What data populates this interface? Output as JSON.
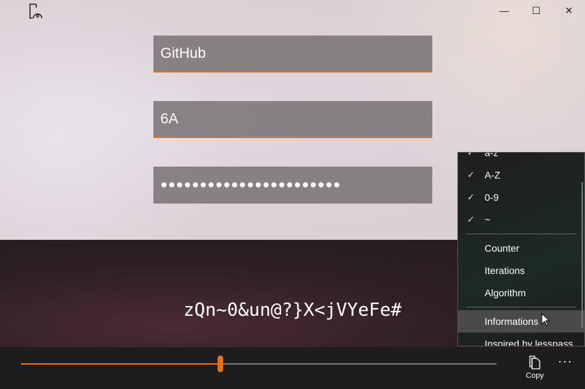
{
  "window": {
    "minimize_icon": "minimize-icon",
    "maximize_icon": "maximize-icon",
    "close_icon": "close-icon"
  },
  "form": {
    "site": "GitHub",
    "login": "6A",
    "master_password": "●●●●●●●●●●●●●●●●●●●●●●●"
  },
  "generated_password": "zQn~0&un@?}X<jVYeFe#",
  "slider": {
    "value_fraction": 0.42,
    "accent": "#e07020"
  },
  "toolbar": {
    "copy_label": "Copy",
    "more_label": "···"
  },
  "menu": {
    "options": [
      {
        "label": "a-z",
        "checked": true
      },
      {
        "label": "A-Z",
        "checked": true
      },
      {
        "label": "0-9",
        "checked": true
      },
      {
        "label": "~",
        "checked": true
      }
    ],
    "settings": [
      "Counter",
      "Iterations",
      "Algorithm"
    ],
    "info": [
      "Informations",
      "Inspired by lesspass"
    ]
  }
}
